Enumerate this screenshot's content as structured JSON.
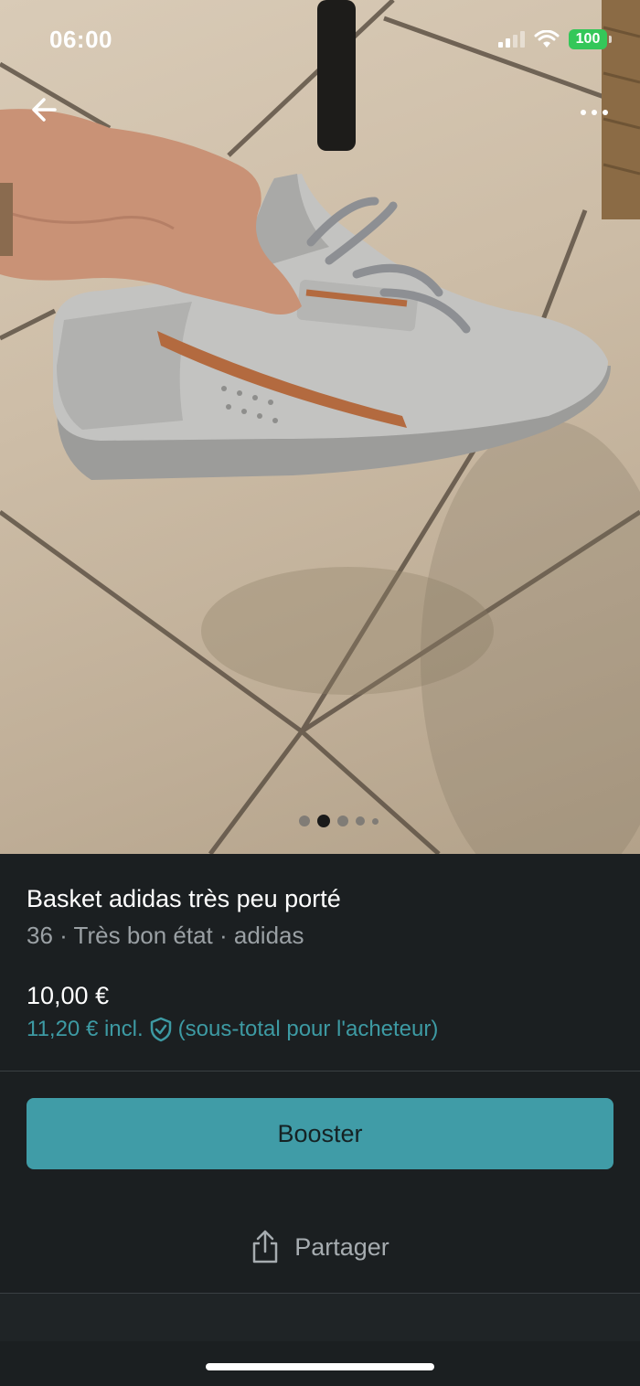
{
  "status_bar": {
    "time": "06:00",
    "battery": "100",
    "battery_color": "#34c759"
  },
  "gallery": {
    "total_images": 5,
    "current_index": 1
  },
  "listing": {
    "title": "Basket adidas très peu porté",
    "subtitle": "36 · Très bon état · adidas",
    "price": "10,00 €",
    "buyer_price": "11,20 € incl.",
    "buyer_note": "(sous-total pour l'acheteur)"
  },
  "actions": {
    "booster_label": "Booster",
    "share_label": "Partager"
  },
  "icons": {
    "back": "arrow-left-icon",
    "more": "more-horizontal-icon",
    "protection": "shield-check-icon",
    "share": "share-icon"
  },
  "colors": {
    "accent": "#409ca7",
    "accent_text": "#3d9aa3",
    "background": "#1b1f21"
  }
}
